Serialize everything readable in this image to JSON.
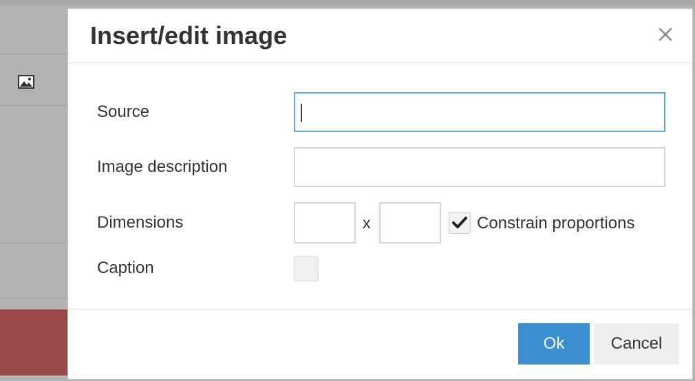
{
  "dialog": {
    "title": "Insert/edit image",
    "close_icon": "close-icon"
  },
  "form": {
    "source": {
      "label": "Source",
      "value": "",
      "placeholder": ""
    },
    "description": {
      "label": "Image description",
      "value": "",
      "placeholder": ""
    },
    "dimensions": {
      "label": "Dimensions",
      "width_value": "",
      "height_value": "",
      "separator": "x",
      "constrain_label": "Constrain proportions",
      "constrain_checked": true
    },
    "caption": {
      "label": "Caption",
      "checked": false
    }
  },
  "footer": {
    "ok_label": "Ok",
    "cancel_label": "Cancel"
  },
  "colors": {
    "primary": "#3a8fd0",
    "focus_border": "#5ca8d9",
    "background_red": "#9a4a4a"
  },
  "background": {
    "toolbar_icon": "image-icon"
  }
}
